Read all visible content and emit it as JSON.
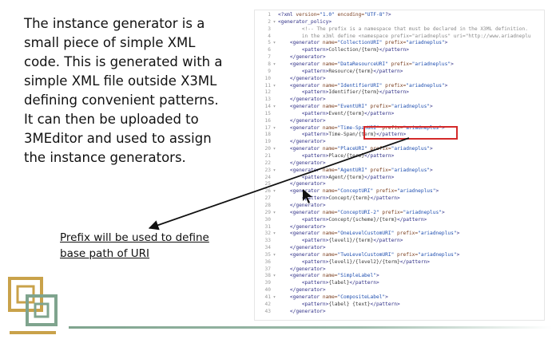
{
  "slide": {
    "body_lines": [
      "The instance generator is a",
      "small piece of simple XML",
      "code. This is generated with a",
      "simple XML file outside X3ML",
      "defining convenient patterns.",
      "It can then be uploaded to",
      "3MEditor and used to assign",
      "the instance generators."
    ],
    "callout_lines": [
      "Prefix will be used to define",
      "base path of URI"
    ]
  },
  "colors": {
    "highlight": "#d42a2a",
    "logo_gold": "#c9a24a",
    "logo_green": "#7fa48e"
  },
  "code": {
    "lines": [
      {
        "n": "1",
        "fold": "",
        "indent": 0,
        "tokens": [
          {
            "t": "tag",
            "v": "<?xml "
          },
          {
            "t": "attr",
            "v": "version="
          },
          {
            "t": "val",
            "v": "\"1.0\" "
          },
          {
            "t": "attr",
            "v": "encoding="
          },
          {
            "t": "val",
            "v": "\"UTF-8\""
          },
          {
            "t": "tag",
            "v": "?>"
          }
        ]
      },
      {
        "n": "2",
        "fold": "▾",
        "indent": 0,
        "tokens": [
          {
            "t": "tag",
            "v": "<generator_policy>"
          }
        ]
      },
      {
        "n": "3",
        "fold": "",
        "indent": 2,
        "tokens": [
          {
            "t": "comment",
            "v": "<!-- The prefix is a namespace that must be declared in the X3ML definition."
          }
        ]
      },
      {
        "n": "4",
        "fold": "",
        "indent": 2,
        "tokens": [
          {
            "t": "comment",
            "v": "in the x3ml define <namespace prefix=\"ariadneplus\" uri=\"http://www.ariadneplu"
          }
        ]
      },
      {
        "n": "5",
        "fold": "▾",
        "indent": 1,
        "tokens": [
          {
            "t": "tag",
            "v": "<generator "
          },
          {
            "t": "attr",
            "v": "name="
          },
          {
            "t": "val",
            "v": "\"CollectionURI\" "
          },
          {
            "t": "attr",
            "v": "prefix="
          },
          {
            "t": "val",
            "v": "\"ariadneplus\""
          },
          {
            "t": "tag",
            "v": ">"
          }
        ]
      },
      {
        "n": "6",
        "fold": "",
        "indent": 2,
        "tokens": [
          {
            "t": "tag",
            "v": "<pattern>"
          },
          {
            "t": "text",
            "v": "Collection/{term}"
          },
          {
            "t": "tag",
            "v": "</pattern>"
          }
        ]
      },
      {
        "n": "7",
        "fold": "",
        "indent": 1,
        "tokens": [
          {
            "t": "tag",
            "v": "</generator>"
          }
        ]
      },
      {
        "n": "8",
        "fold": "▾",
        "indent": 1,
        "tokens": [
          {
            "t": "tag",
            "v": "<generator "
          },
          {
            "t": "attr",
            "v": "name="
          },
          {
            "t": "val",
            "v": "\"DataResourceURI\" "
          },
          {
            "t": "attr",
            "v": "prefix="
          },
          {
            "t": "val",
            "v": "\"ariadneplus\""
          },
          {
            "t": "tag",
            "v": ">"
          }
        ]
      },
      {
        "n": "9",
        "fold": "",
        "indent": 2,
        "tokens": [
          {
            "t": "tag",
            "v": "<pattern>"
          },
          {
            "t": "text",
            "v": "Resource/{term}"
          },
          {
            "t": "tag",
            "v": "</pattern>"
          }
        ]
      },
      {
        "n": "10",
        "fold": "",
        "indent": 1,
        "tokens": [
          {
            "t": "tag",
            "v": "</generator>"
          }
        ]
      },
      {
        "n": "11",
        "fold": "▾",
        "indent": 1,
        "tokens": [
          {
            "t": "tag",
            "v": "<generator "
          },
          {
            "t": "attr",
            "v": "name="
          },
          {
            "t": "val",
            "v": "\"IdentifierURI\" "
          },
          {
            "t": "attr",
            "v": "prefix="
          },
          {
            "t": "val",
            "v": "\"ariadneplus\""
          },
          {
            "t": "tag",
            "v": ">"
          }
        ]
      },
      {
        "n": "12",
        "fold": "",
        "indent": 2,
        "tokens": [
          {
            "t": "tag",
            "v": "<pattern>"
          },
          {
            "t": "text",
            "v": "Identifier/{term}"
          },
          {
            "t": "tag",
            "v": "</pattern>"
          }
        ]
      },
      {
        "n": "13",
        "fold": "",
        "indent": 1,
        "tokens": [
          {
            "t": "tag",
            "v": "</generator>"
          }
        ]
      },
      {
        "n": "14",
        "fold": "▾",
        "indent": 1,
        "tokens": [
          {
            "t": "tag",
            "v": "<generator "
          },
          {
            "t": "attr",
            "v": "name="
          },
          {
            "t": "val",
            "v": "\"EventURI\" "
          },
          {
            "t": "attr",
            "v": "prefix="
          },
          {
            "t": "val",
            "v": "\"ariadneplus\""
          },
          {
            "t": "tag",
            "v": ">"
          }
        ]
      },
      {
        "n": "15",
        "fold": "",
        "indent": 2,
        "tokens": [
          {
            "t": "tag",
            "v": "<pattern>"
          },
          {
            "t": "text",
            "v": "Event/{term}"
          },
          {
            "t": "tag",
            "v": "</pattern>"
          }
        ]
      },
      {
        "n": "16",
        "fold": "",
        "indent": 1,
        "tokens": [
          {
            "t": "tag",
            "v": "</generator>"
          }
        ]
      },
      {
        "n": "17",
        "fold": "▾",
        "indent": 1,
        "tokens": [
          {
            "t": "tag",
            "v": "<generator "
          },
          {
            "t": "attr",
            "v": "name="
          },
          {
            "t": "val",
            "v": "\"Time-SpanURI\" "
          },
          {
            "t": "attr",
            "v": "prefix="
          },
          {
            "t": "val",
            "v": "\"ariadneplus\""
          },
          {
            "t": "tag",
            "v": ">"
          }
        ]
      },
      {
        "n": "18",
        "fold": "",
        "indent": 2,
        "tokens": [
          {
            "t": "tag",
            "v": "<pattern>"
          },
          {
            "t": "text",
            "v": "Time-Span/{term}"
          },
          {
            "t": "tag",
            "v": "</pattern>"
          }
        ]
      },
      {
        "n": "19",
        "fold": "",
        "indent": 1,
        "tokens": [
          {
            "t": "tag",
            "v": "</generator>"
          }
        ]
      },
      {
        "n": "20",
        "fold": "▾",
        "indent": 1,
        "tokens": [
          {
            "t": "tag",
            "v": "<generator "
          },
          {
            "t": "attr",
            "v": "name="
          },
          {
            "t": "val",
            "v": "\"PlaceURI\" "
          },
          {
            "t": "attr",
            "v": "prefix="
          },
          {
            "t": "val",
            "v": "\"ariadneplus\""
          },
          {
            "t": "tag",
            "v": ">"
          }
        ]
      },
      {
        "n": "21",
        "fold": "",
        "indent": 2,
        "tokens": [
          {
            "t": "tag",
            "v": "<pattern>"
          },
          {
            "t": "text",
            "v": "Place/{term}"
          },
          {
            "t": "tag",
            "v": "</pattern>"
          }
        ]
      },
      {
        "n": "22",
        "fold": "",
        "indent": 1,
        "tokens": [
          {
            "t": "tag",
            "v": "</generator>"
          }
        ]
      },
      {
        "n": "23",
        "fold": "▾",
        "indent": 1,
        "tokens": [
          {
            "t": "tag",
            "v": "<generator "
          },
          {
            "t": "attr",
            "v": "name="
          },
          {
            "t": "val",
            "v": "\"AgentURI\" "
          },
          {
            "t": "attr",
            "v": "prefix="
          },
          {
            "t": "val",
            "v": "\"ariadneplus\""
          },
          {
            "t": "tag",
            "v": ">"
          }
        ]
      },
      {
        "n": "24",
        "fold": "",
        "indent": 2,
        "tokens": [
          {
            "t": "tag",
            "v": "<pattern>"
          },
          {
            "t": "text",
            "v": "Agent/{term}"
          },
          {
            "t": "tag",
            "v": "</pattern>"
          }
        ]
      },
      {
        "n": "25",
        "fold": "",
        "indent": 1,
        "tokens": [
          {
            "t": "tag",
            "v": "</generator>"
          }
        ]
      },
      {
        "n": "26",
        "fold": "▾",
        "indent": 1,
        "tokens": [
          {
            "t": "tag",
            "v": "<generator "
          },
          {
            "t": "attr",
            "v": "name="
          },
          {
            "t": "val",
            "v": "\"ConceptURI\" "
          },
          {
            "t": "attr",
            "v": "prefix="
          },
          {
            "t": "val",
            "v": "\"ariadneplus\""
          },
          {
            "t": "tag",
            "v": ">"
          }
        ]
      },
      {
        "n": "27",
        "fold": "",
        "indent": 2,
        "tokens": [
          {
            "t": "tag",
            "v": "<pattern>"
          },
          {
            "t": "text",
            "v": "Concept/{term}"
          },
          {
            "t": "tag",
            "v": "</pattern>"
          }
        ]
      },
      {
        "n": "28",
        "fold": "",
        "indent": 1,
        "tokens": [
          {
            "t": "tag",
            "v": "</generator>"
          }
        ]
      },
      {
        "n": "29",
        "fold": "▾",
        "indent": 1,
        "tokens": [
          {
            "t": "tag",
            "v": "<generator "
          },
          {
            "t": "attr",
            "v": "name="
          },
          {
            "t": "val",
            "v": "\"ConceptURI-2\" "
          },
          {
            "t": "attr",
            "v": "prefix="
          },
          {
            "t": "val",
            "v": "\"ariadneplus\""
          },
          {
            "t": "tag",
            "v": ">"
          }
        ]
      },
      {
        "n": "30",
        "fold": "",
        "indent": 2,
        "tokens": [
          {
            "t": "tag",
            "v": "<pattern>"
          },
          {
            "t": "text",
            "v": "Concept/{scheme}/{term}"
          },
          {
            "t": "tag",
            "v": "</pattern>"
          }
        ]
      },
      {
        "n": "31",
        "fold": "",
        "indent": 1,
        "tokens": [
          {
            "t": "tag",
            "v": "</generator>"
          }
        ]
      },
      {
        "n": "32",
        "fold": "▾",
        "indent": 1,
        "tokens": [
          {
            "t": "tag",
            "v": "<generator "
          },
          {
            "t": "attr",
            "v": "name="
          },
          {
            "t": "val",
            "v": "\"OneLevelCustomURI\" "
          },
          {
            "t": "attr",
            "v": "prefix="
          },
          {
            "t": "val",
            "v": "\"ariadneplus\""
          },
          {
            "t": "tag",
            "v": ">"
          }
        ]
      },
      {
        "n": "33",
        "fold": "",
        "indent": 2,
        "tokens": [
          {
            "t": "tag",
            "v": "<pattern>"
          },
          {
            "t": "text",
            "v": "{level1}/{term}"
          },
          {
            "t": "tag",
            "v": "</pattern>"
          }
        ]
      },
      {
        "n": "34",
        "fold": "",
        "indent": 1,
        "tokens": [
          {
            "t": "tag",
            "v": "</generator>"
          }
        ]
      },
      {
        "n": "35",
        "fold": "▾",
        "indent": 1,
        "tokens": [
          {
            "t": "tag",
            "v": "<generator "
          },
          {
            "t": "attr",
            "v": "name="
          },
          {
            "t": "val",
            "v": "\"TwoLevelCustomURI\" "
          },
          {
            "t": "attr",
            "v": "prefix="
          },
          {
            "t": "val",
            "v": "\"ariadneplus\""
          },
          {
            "t": "tag",
            "v": ">"
          }
        ]
      },
      {
        "n": "36",
        "fold": "",
        "indent": 2,
        "tokens": [
          {
            "t": "tag",
            "v": "<pattern>"
          },
          {
            "t": "text",
            "v": "{level1}/{level2}/{term}"
          },
          {
            "t": "tag",
            "v": "</pattern>"
          }
        ]
      },
      {
        "n": "37",
        "fold": "",
        "indent": 1,
        "tokens": [
          {
            "t": "tag",
            "v": "</generator>"
          }
        ]
      },
      {
        "n": "38",
        "fold": "▾",
        "indent": 1,
        "tokens": [
          {
            "t": "tag",
            "v": "<generator "
          },
          {
            "t": "attr",
            "v": "name="
          },
          {
            "t": "val",
            "v": "\"SimpleLabel\""
          },
          {
            "t": "tag",
            "v": ">"
          }
        ]
      },
      {
        "n": "39",
        "fold": "",
        "indent": 2,
        "tokens": [
          {
            "t": "tag",
            "v": "<pattern>"
          },
          {
            "t": "text",
            "v": "{label}"
          },
          {
            "t": "tag",
            "v": "</pattern>"
          }
        ]
      },
      {
        "n": "40",
        "fold": "",
        "indent": 1,
        "tokens": [
          {
            "t": "tag",
            "v": "</generator>"
          }
        ]
      },
      {
        "n": "41",
        "fold": "▾",
        "indent": 1,
        "tokens": [
          {
            "t": "tag",
            "v": "<generator "
          },
          {
            "t": "attr",
            "v": "name="
          },
          {
            "t": "val",
            "v": "\"CompositeLabel\""
          },
          {
            "t": "tag",
            "v": ">"
          }
        ]
      },
      {
        "n": "42",
        "fold": "",
        "indent": 2,
        "tokens": [
          {
            "t": "tag",
            "v": "<pattern>"
          },
          {
            "t": "text",
            "v": "{label} {text}"
          },
          {
            "t": "tag",
            "v": "</pattern>"
          }
        ]
      },
      {
        "n": "43",
        "fold": "",
        "indent": 1,
        "tokens": [
          {
            "t": "tag",
            "v": "</generator>"
          }
        ]
      }
    ]
  }
}
